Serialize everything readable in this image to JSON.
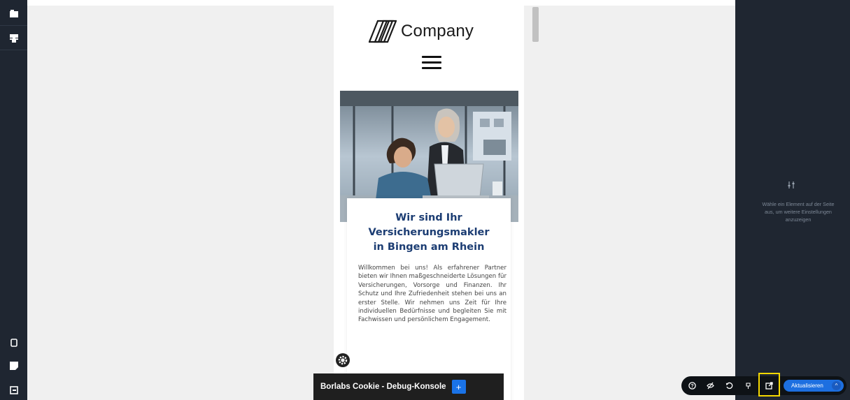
{
  "left_toolbar": {
    "items": [
      {
        "icon": "folder-icon"
      },
      {
        "icon": "component-icon"
      },
      {
        "icon": "mobile-device-icon"
      },
      {
        "icon": "note-icon"
      },
      {
        "icon": "exit-icon"
      }
    ]
  },
  "preview": {
    "logo_text": "Company",
    "hero_image_alt": "two-women-laptop-office",
    "card": {
      "title_lines": [
        "Wir sind Ihr",
        "Versicherungsmakler",
        "in Bingen am Rhein"
      ],
      "body": "Willkommen bei uns! Als erfahrener Partner bieten wir Ihnen maßgeschneiderte Lösungen für Versicherungen, Vorsorge und Finanzen. Ihr Schutz und Ihre Zufriedenheit stehen bei uns an erster Stelle. Wir nehmen uns Zeit für Ihre individuellen Bedürfnisse und begleiten Sie mit Fachwissen und persönlichem Engagement."
    }
  },
  "cookie_console": {
    "label": "Borlabs Cookie - Debug-Konsole",
    "button": "+"
  },
  "right_panel": {
    "icon": "sliders-icon",
    "hint": "Wähle ein Element auf der Seite aus, um weitere Einstellungen anzuzeigen"
  },
  "action_bar": {
    "buttons": [
      {
        "icon": "help-icon"
      },
      {
        "icon": "visibility-off-icon"
      },
      {
        "icon": "history-icon"
      },
      {
        "icon": "responsive-icon"
      },
      {
        "icon": "open-external-icon"
      }
    ],
    "update_label": "Aktualisieren",
    "update_caret": "^"
  },
  "colors": {
    "panel_bg": "#1f2631",
    "canvas_bg": "#f0f0f0",
    "title_blue": "#1c3d73",
    "accent_blue": "#1d6fe0",
    "highlight_yellow": "#f5d800"
  }
}
